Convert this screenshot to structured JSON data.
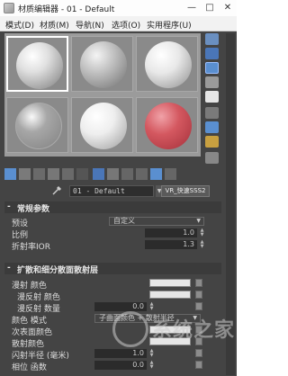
{
  "titlebar": {
    "title": "材质编辑器 - 01 - Default",
    "minimize": "—",
    "maximize": "□",
    "close": "✕"
  },
  "menubar": {
    "items": [
      "模式(D)",
      "材质(M)",
      "导航(N)",
      "选项(O)",
      "实用程序(U)"
    ]
  },
  "name_row": {
    "material_name": "01 - Default",
    "material_type": "VR_快速SSS2"
  },
  "basic_params": {
    "sign": "-",
    "title": "常规参数",
    "preset_label": "预设",
    "preset_value": "自定义",
    "scale_label": "比例",
    "scale_value": "1.0",
    "ior_label": "折射率IOR",
    "ior_value": "1.3"
  },
  "diffuse_sss": {
    "sign": "-",
    "title": "扩散和细分散面散射层",
    "rows": [
      {
        "label": "漫射 颜色",
        "kind": "color"
      },
      {
        "label": "漫反射 颜色",
        "kind": "color"
      },
      {
        "label": "漫反射 数量",
        "kind": "number",
        "value": "0.0"
      },
      {
        "label": "颜色 模式",
        "kind": "select",
        "value": "子曲面颜色 + 散射半径"
      },
      {
        "label": "次表面颜色",
        "kind": "color"
      },
      {
        "label": "散射颜色",
        "kind": "color"
      },
      {
        "label": "闪射半径 (毫米)",
        "kind": "number",
        "value": "1.0"
      },
      {
        "label": "相位 函数",
        "kind": "number",
        "value": "0.0"
      }
    ]
  },
  "watermark": {
    "text": "系统之家"
  },
  "colors": {
    "panel": "#444444",
    "swatch": "#e6e6e6",
    "accent": "#5a8fd0",
    "red_sphere": "#d45860"
  }
}
